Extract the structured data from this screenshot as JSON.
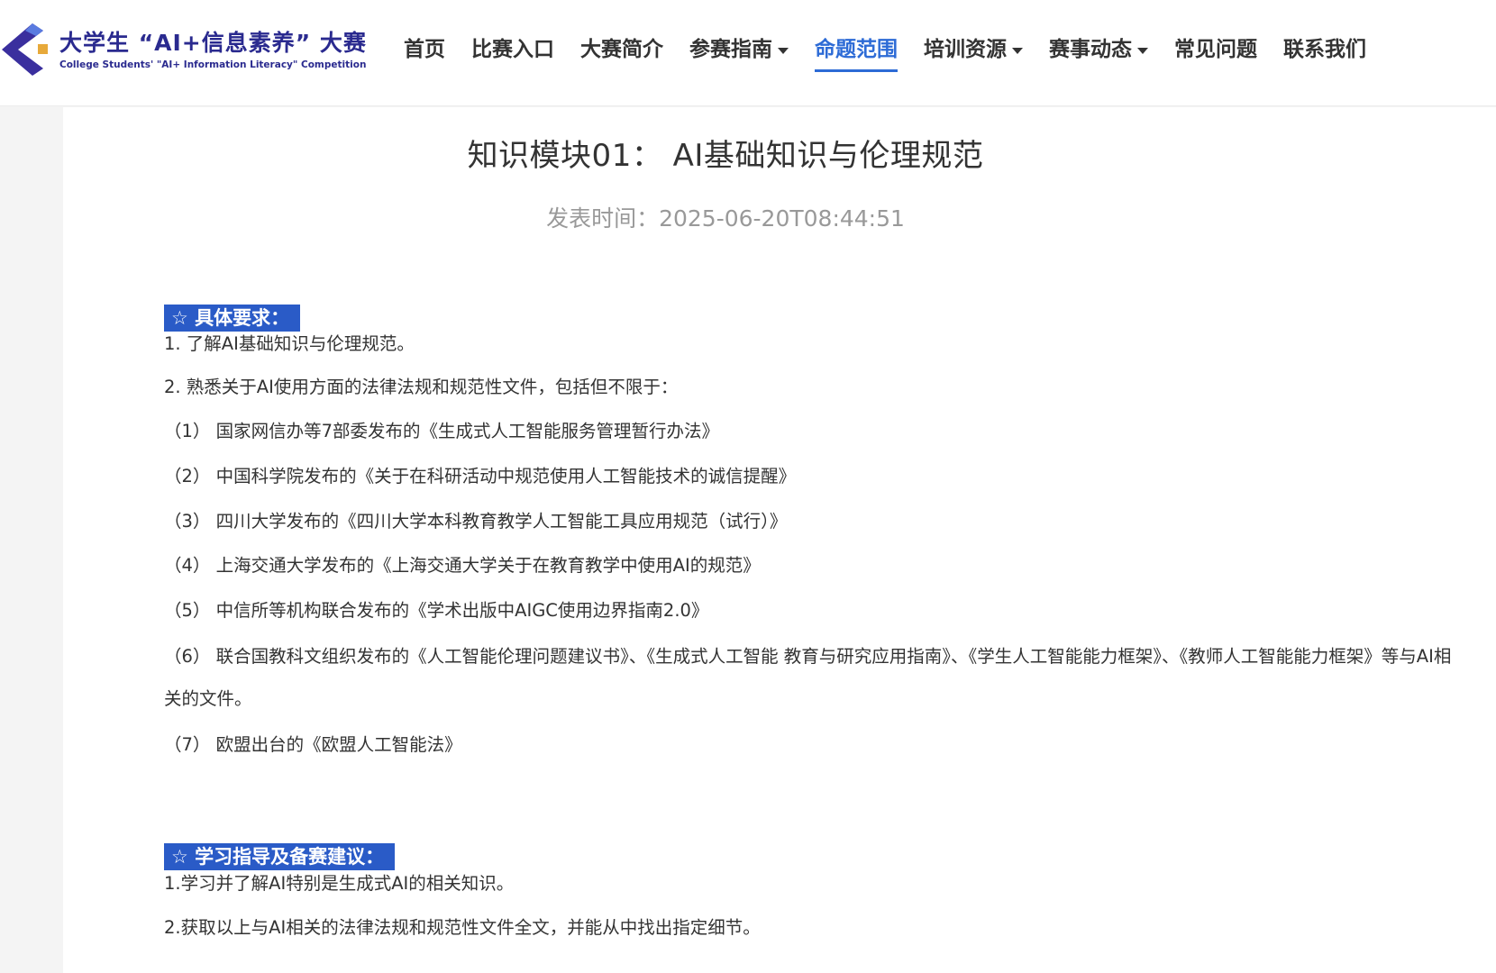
{
  "header": {
    "logo_title": "大学生 “AI+信息素养” 大赛",
    "logo_subtitle": "College Students' \"AI+ Information Literacy\" Competition",
    "nav": [
      {
        "label": "首页",
        "dropdown": false,
        "active": false
      },
      {
        "label": "比赛入口",
        "dropdown": false,
        "active": false
      },
      {
        "label": "大赛简介",
        "dropdown": false,
        "active": false
      },
      {
        "label": "参赛指南",
        "dropdown": true,
        "active": false
      },
      {
        "label": "命题范围",
        "dropdown": false,
        "active": true
      },
      {
        "label": "培训资源",
        "dropdown": true,
        "active": false
      },
      {
        "label": "赛事动态",
        "dropdown": true,
        "active": false
      },
      {
        "label": "常见问题",
        "dropdown": false,
        "active": false
      },
      {
        "label": "联系我们",
        "dropdown": false,
        "active": false
      }
    ]
  },
  "article": {
    "title": "知识模块01： AI基础知识与伦理规范",
    "publish_time": "发表时间：2025-06-20T08:44:51",
    "section1": {
      "heading": "☆ 具体要求：",
      "lines": [
        "1. 了解AI基础知识与伦理规范。",
        "2. 熟悉关于AI使用方面的法律法规和规范性文件，包括但不限于：",
        "（1） 国家网信办等7部委发布的《生成式人工智能服务管理暂行办法》",
        "（2） 中国科学院发布的《关于在科研活动中规范使用人工智能技术的诚信提醒》",
        "（3） 四川大学发布的《四川大学本科教育教学人工智能工具应用规范（试行）》",
        "（4） 上海交通大学发布的《上海交通大学关于在教育教学中使用AI的规范》",
        "（5） 中信所等机构联合发布的《学术出版中AIGC使用边界指南2.0》",
        "（6） 联合国教科文组织发布的《人工智能伦理问题建议书》、《生成式人工智能 教育与研究应用指南》、《学生人工智能能力框架》、《教师人工智能能力框架》等与AI相关的文件。",
        "（7） 欧盟出台的《欧盟人工智能法》"
      ]
    },
    "section2": {
      "heading": "☆ 学习指导及备赛建议：",
      "lines": [
        "1.学习并了解AI特别是生成式AI的相关知识。",
        "2.获取以上与AI相关的法律法规和规范性文件全文，并能从中找出指定细节。"
      ]
    }
  },
  "colors": {
    "accent": "#2d6bd6",
    "badge": "#2a5bc7",
    "logo": "#2a2a8f",
    "logo_square": "#e7a93a"
  }
}
